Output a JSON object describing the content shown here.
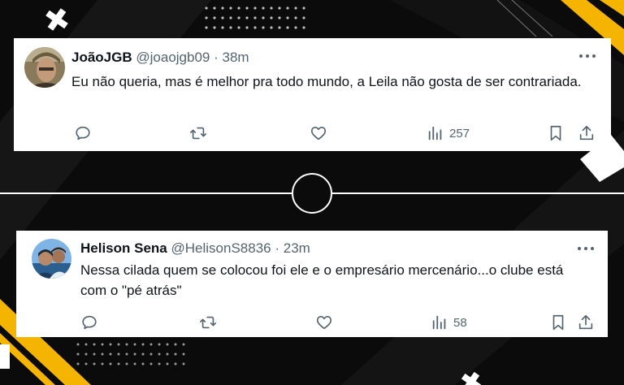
{
  "tweets": [
    {
      "name": "JoãoJGB",
      "handle": "@joaojgb09",
      "separator": "·",
      "time": "38m",
      "text": "Eu não queria, mas é melhor pra todo mundo, a Leila não gosta de ser contrariada.",
      "views": "257"
    },
    {
      "name": "Helison Sena",
      "handle": "@HelisonS8836",
      "separator": "·",
      "time": "23m",
      "text": "Nessa cilada quem se colocou foi ele e o empresário mercenário...o clube está com o \"pé atrás\"",
      "views": "58"
    }
  ],
  "icons": [
    "reply-icon",
    "retweet-icon",
    "like-icon",
    "views-icon",
    "bookmark-icon",
    "share-icon",
    "more-icon"
  ],
  "colors": {
    "background": "#0b0b0b",
    "accent_yellow": "#f5b400",
    "text_primary": "#0f1419",
    "text_secondary": "#536471"
  }
}
